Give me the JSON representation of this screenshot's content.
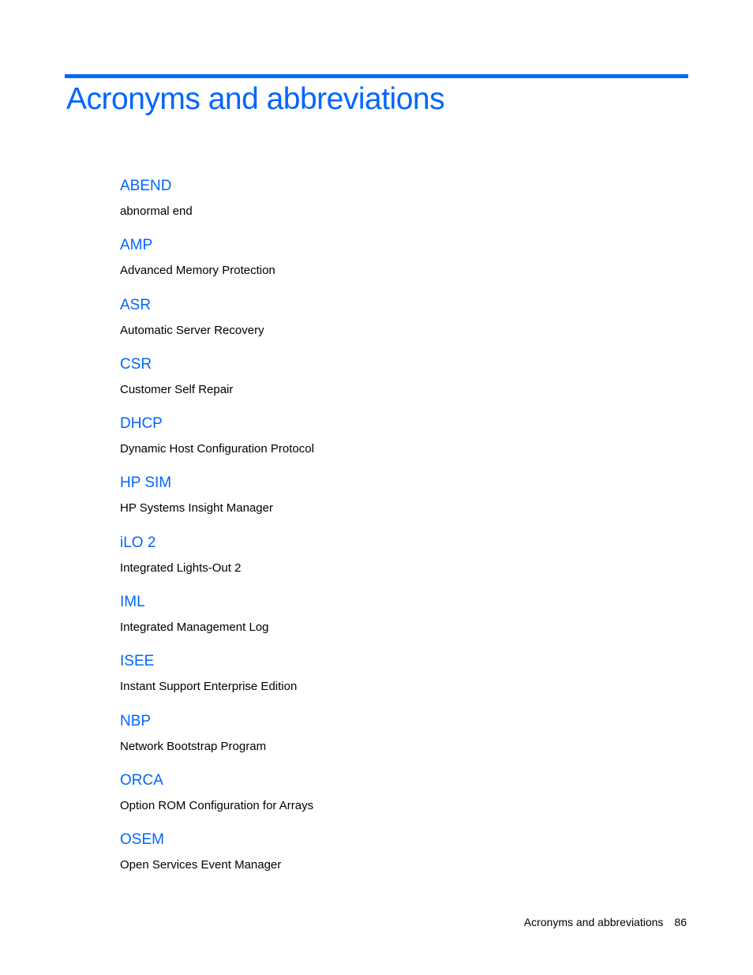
{
  "page": {
    "title": "Acronyms and abbreviations",
    "accent_color": "#0066ff"
  },
  "entries": [
    {
      "term": "ABEND",
      "definition": "abnormal end"
    },
    {
      "term": "AMP",
      "definition": "Advanced Memory Protection"
    },
    {
      "term": "ASR",
      "definition": "Automatic Server Recovery"
    },
    {
      "term": "CSR",
      "definition": "Customer Self Repair"
    },
    {
      "term": "DHCP",
      "definition": "Dynamic Host Configuration Protocol"
    },
    {
      "term": "HP SIM",
      "definition": "HP Systems Insight Manager"
    },
    {
      "term": "iLO 2",
      "definition": "Integrated Lights-Out 2"
    },
    {
      "term": "IML",
      "definition": "Integrated Management Log"
    },
    {
      "term": "ISEE",
      "definition": "Instant Support Enterprise Edition"
    },
    {
      "term": "NBP",
      "definition": "Network Bootstrap Program"
    },
    {
      "term": "ORCA",
      "definition": "Option ROM Configuration for Arrays"
    },
    {
      "term": "OSEM",
      "definition": "Open Services Event Manager"
    }
  ],
  "footer": {
    "section": "Acronyms and abbreviations",
    "page_number": "86"
  }
}
